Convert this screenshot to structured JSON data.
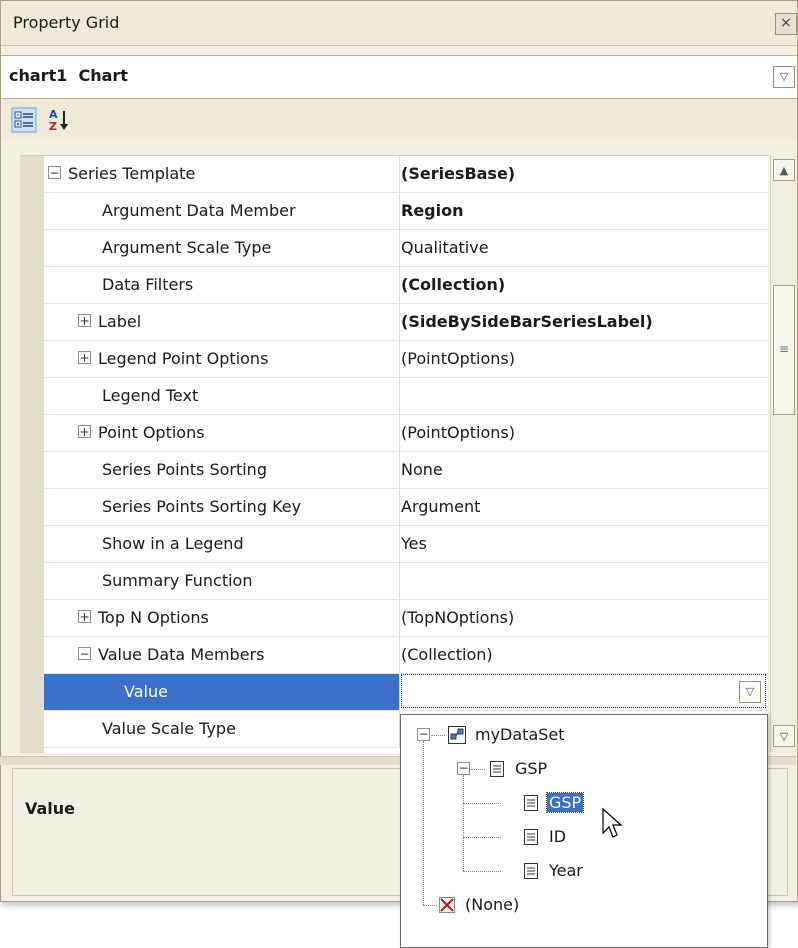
{
  "window": {
    "title": "Property Grid",
    "close_glyph": "×"
  },
  "object_selector": {
    "name": "chart1",
    "type": "Chart"
  },
  "toolbar": {
    "buttons": [
      {
        "icon": "categorized-view-icon"
      },
      {
        "icon": "alphabetical-sort-icon"
      }
    ]
  },
  "properties": [
    {
      "name": "Series Template",
      "value": "(SeriesBase)",
      "bold": true,
      "expander": "minus",
      "indent": 0
    },
    {
      "name": "Argument Data Member",
      "value": "Region",
      "bold": true,
      "indent": 1
    },
    {
      "name": "Argument Scale Type",
      "value": "Qualitative",
      "indent": 1
    },
    {
      "name": "Data Filters",
      "value": "(Collection)",
      "bold": true,
      "indent": 1
    },
    {
      "name": "Label",
      "value": "(SideBySideBarSeriesLabel)",
      "bold": true,
      "expander": "plus",
      "indent": 1
    },
    {
      "name": "Legend Point Options",
      "value": "(PointOptions)",
      "expander": "plus",
      "indent": 1
    },
    {
      "name": "Legend Text",
      "value": "",
      "indent": 1
    },
    {
      "name": "Point Options",
      "value": "(PointOptions)",
      "expander": "plus",
      "indent": 1
    },
    {
      "name": "Series Points Sorting",
      "value": "None",
      "indent": 1
    },
    {
      "name": "Series Points Sorting Key",
      "value": "Argument",
      "indent": 1
    },
    {
      "name": "Show in a Legend",
      "value": "Yes",
      "indent": 1
    },
    {
      "name": "Summary Function",
      "value": "",
      "indent": 1
    },
    {
      "name": "Top N Options",
      "value": "(TopNOptions)",
      "expander": "plus",
      "indent": 1
    },
    {
      "name": "Value Data Members",
      "value": "(Collection)",
      "expander": "minus",
      "indent": 1
    },
    {
      "name": "Value",
      "value": "",
      "selected": true,
      "indent": 2
    },
    {
      "name": "Value Scale Type",
      "value": "",
      "indent": 1
    }
  ],
  "description": {
    "title": "Value"
  },
  "popup_tree": [
    {
      "label": "myDataSet",
      "icon": "dataset-icon",
      "level": 0,
      "expander": "minus"
    },
    {
      "label": "GSP",
      "icon": "table-icon",
      "level": 1,
      "expander": "minus"
    },
    {
      "label": "GSP",
      "icon": "field-icon",
      "level": 2,
      "selected": true
    },
    {
      "label": "ID",
      "icon": "field-icon",
      "level": 2
    },
    {
      "label": "Year",
      "icon": "field-icon",
      "level": 2
    },
    {
      "label": "(None)",
      "icon": "none-icon",
      "level": 0
    }
  ],
  "colors": {
    "selection": "#3a6fca",
    "chrome": "#efe9da",
    "gutter": "#e3ddcd"
  }
}
